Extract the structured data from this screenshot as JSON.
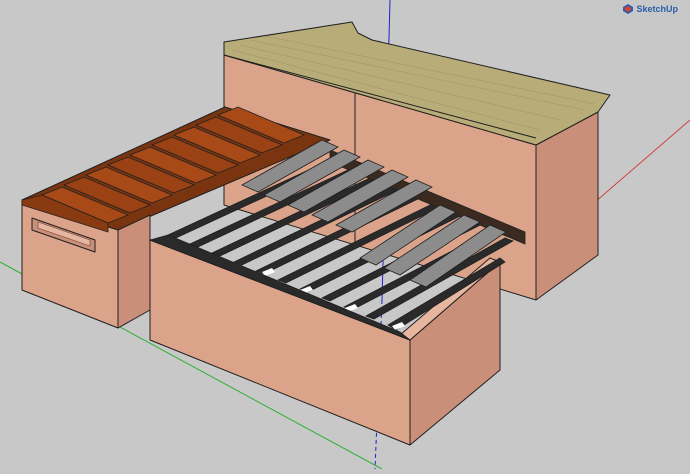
{
  "app": {
    "brand_text": "SketchUp",
    "logo_icon": "sketchup-logo-icon"
  },
  "colors": {
    "background": "#c8c8c8",
    "axis_blue": "#2020d0",
    "axis_red": "#d04040",
    "axis_green": "#30b030",
    "wall_front": "#dba38a",
    "wall_side": "#c98f78",
    "wall_top": "#e6b6a0",
    "wood_top": "#b8ad78",
    "wood_dark": "#8a3a10",
    "wood_mid": "#a84a18",
    "slat_gray": "#8c8c8c",
    "slat_dark": "#2a2a2a",
    "edge": "#202020"
  }
}
